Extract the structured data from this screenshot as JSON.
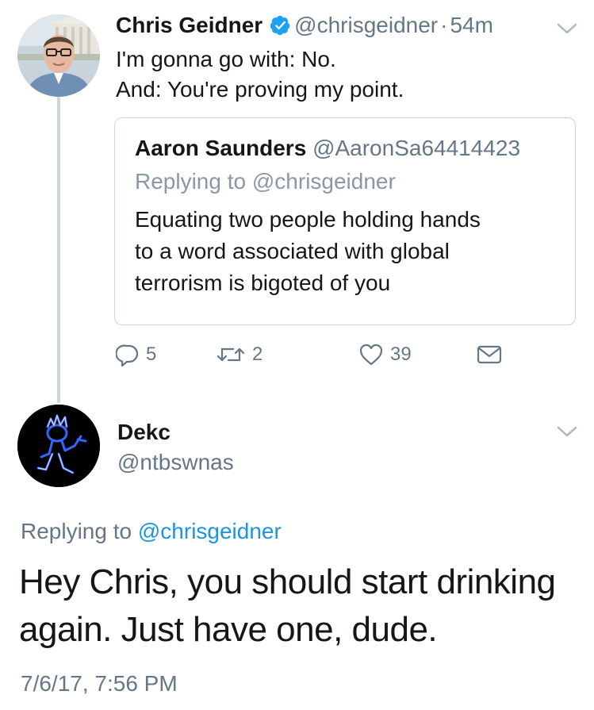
{
  "tweet1": {
    "name": "Chris Geidner",
    "handle": "@chrisgeidner",
    "separator": "·",
    "time": "54m",
    "lines": [
      "I'm gonna go with: No.",
      "And: You're proving my point."
    ],
    "avatar_icon": "profile-photo",
    "verified_icon": "verified-badge-icon",
    "quoted": {
      "name": "Aaron Saunders",
      "handle": "@AaronSa64414423",
      "replying_prefix": "Replying to",
      "replying_handle": "@chrisgeidner",
      "lines": [
        "Equating two people holding hands",
        "to a word associated with global",
        "terrorism is bigoted of you"
      ]
    },
    "actions": {
      "reply_count": "5",
      "retweet_count": "2",
      "like_count": "39"
    }
  },
  "tweet2": {
    "name": "Dekc",
    "handle": "@ntbswnas",
    "avatar_icon": "hatchetman-avatar",
    "replying_prefix": "Replying to",
    "replying_handle": "@chrisgeidner",
    "lines": [
      "Hey Chris, you should start drinking",
      "again. Just have one, dude."
    ],
    "timestamp": "7/6/17, 7:56 PM"
  },
  "colors": {
    "text": "#14171a",
    "muted": "#657786",
    "link": "#1b95e0",
    "border": "#ccd6dd",
    "verified": "#1da1f2"
  }
}
